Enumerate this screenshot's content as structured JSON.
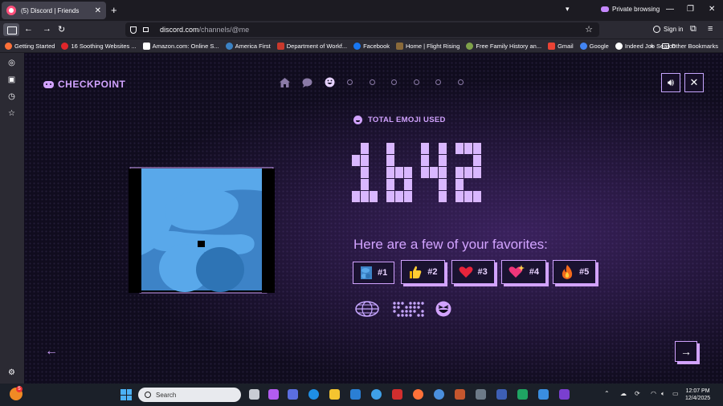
{
  "browser": {
    "tab_title": "(5) Discord | Friends",
    "private_label": "Private browsing",
    "url_host": "discord.com",
    "url_path": "/channels/@me",
    "sign_in_label": "Sign in",
    "bookmarks": [
      {
        "label": "Getting Started",
        "color": "#ff7139"
      },
      {
        "label": "16 Soothing Websites ...",
        "color": "#e0262b"
      },
      {
        "label": "Amazon.com: Online S...",
        "color": "#ffffff"
      },
      {
        "label": "America First",
        "color": "#3b82c4"
      },
      {
        "label": "Department of Workf...",
        "color": "#c9392c"
      },
      {
        "label": "Facebook",
        "color": "#1877f2"
      },
      {
        "label": "Home | Flight Rising",
        "color": "#8a6a3a"
      },
      {
        "label": "Free Family History an...",
        "color": "#7fa24a"
      },
      {
        "label": "Gmail",
        "color": "#ea4335"
      },
      {
        "label": "Google",
        "color": "#4285f4"
      },
      {
        "label": "Indeed Job Search",
        "color": "#ffffff"
      }
    ],
    "other_bookmarks_label": "Other Bookmarks"
  },
  "checkpoint": {
    "logo_text": "CHECKPOINT",
    "stepper": {
      "icons": [
        "home-icon",
        "chat-bubble-icon",
        "emoji-face-icon"
      ],
      "active_index": 2,
      "pending_dots": 6
    },
    "stat_label": "TOTAL EMOJI USED",
    "stat_value": "1642",
    "favorites_heading": "Here are a few of your favorites:",
    "favorites": [
      {
        "rank": "#1",
        "emoji": "custom-blue-emoji-icon"
      },
      {
        "rank": "#2",
        "emoji": "thumbs-up-icon"
      },
      {
        "rank": "#3",
        "emoji": "red-heart-icon"
      },
      {
        "rank": "#4",
        "emoji": "sparkling-heart-icon"
      },
      {
        "rank": "#5",
        "emoji": "fire-icon"
      }
    ],
    "accent_color": "#d2a3ff"
  },
  "taskbar": {
    "weather_badge": "5",
    "search_placeholder": "Search",
    "time": "12:07 PM",
    "date": "12/4/2025"
  }
}
